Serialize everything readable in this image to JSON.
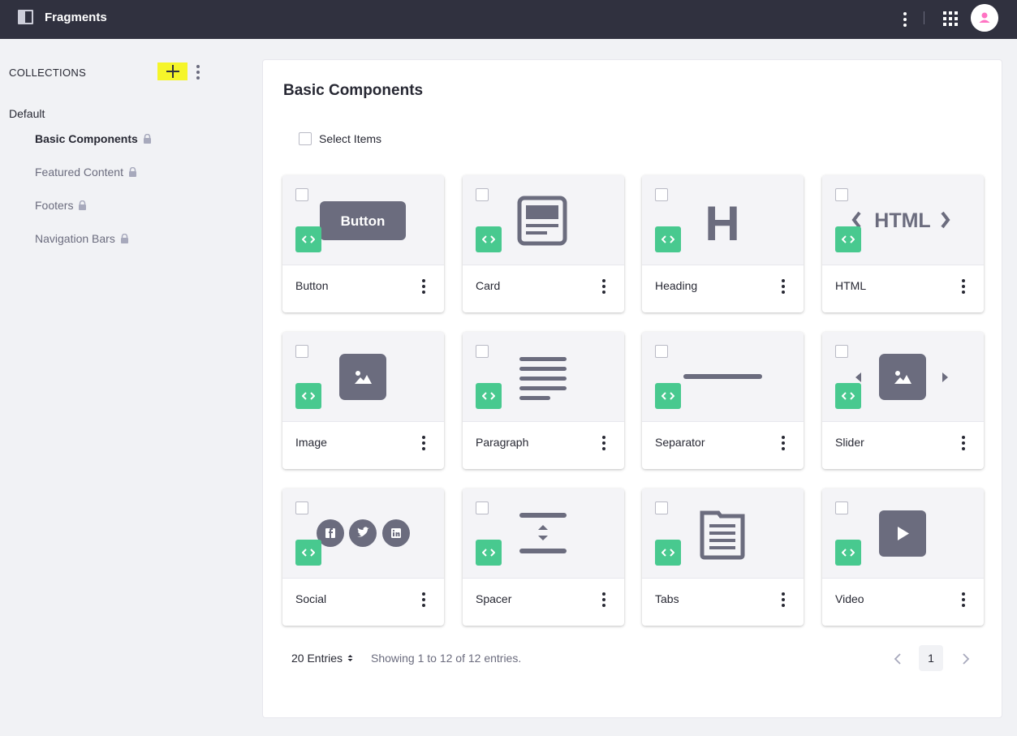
{
  "app": {
    "title": "Fragments"
  },
  "sidebar": {
    "collections_label": "COLLECTIONS",
    "group_label": "Default",
    "items": [
      {
        "label": "Basic Components",
        "active": true
      },
      {
        "label": "Featured Content",
        "active": false
      },
      {
        "label": "Footers",
        "active": false
      },
      {
        "label": "Navigation Bars",
        "active": false
      }
    ]
  },
  "main": {
    "title": "Basic Components",
    "select_items_label": "Select Items",
    "cards": [
      {
        "name": "Button",
        "icon": "button-preview-icon",
        "illus_text": "Button"
      },
      {
        "name": "Card",
        "icon": "card-preview-icon"
      },
      {
        "name": "Heading",
        "icon": "heading-preview-icon",
        "illus_text": "H"
      },
      {
        "name": "HTML",
        "icon": "html-preview-icon",
        "illus_text": "HTML"
      },
      {
        "name": "Image",
        "icon": "image-preview-icon"
      },
      {
        "name": "Paragraph",
        "icon": "paragraph-preview-icon"
      },
      {
        "name": "Separator",
        "icon": "separator-preview-icon"
      },
      {
        "name": "Slider",
        "icon": "slider-preview-icon"
      },
      {
        "name": "Social",
        "icon": "social-preview-icon"
      },
      {
        "name": "Spacer",
        "icon": "spacer-preview-icon"
      },
      {
        "name": "Tabs",
        "icon": "tabs-preview-icon"
      },
      {
        "name": "Video",
        "icon": "video-preview-icon"
      }
    ],
    "footer": {
      "entries_label": "20 Entries",
      "showing_text": "Showing 1 to 12 of 12 entries.",
      "current_page": "1"
    }
  },
  "colors": {
    "topbar": "#30313f",
    "code_badge": "#48c98f",
    "illustration": "#6b6c7e",
    "highlight": "#f5f52a",
    "avatar_icon": "#ff73c3"
  }
}
